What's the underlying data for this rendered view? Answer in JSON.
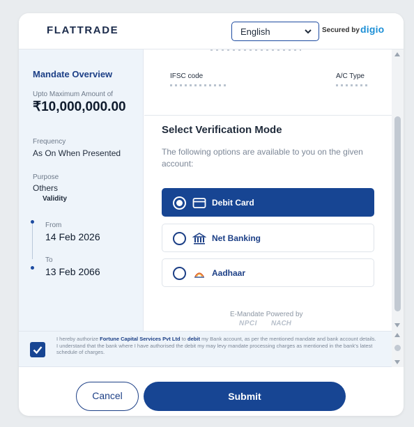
{
  "header": {
    "logo_text": "FLATTRADE",
    "language_selected": "English",
    "secured_by_label": "Secured by",
    "secured_by_brand": "digio"
  },
  "mandate": {
    "title": "Mandate Overview",
    "amount_label": "Upto Maximum Amount of",
    "amount_value": "₹10,000,000.00",
    "frequency_label": "Frequency",
    "frequency_value": "As On When Presented",
    "purpose_label": "Purpose",
    "purpose_value": "Others",
    "validity_label": "Validity",
    "from_label": "From",
    "from_value": "14 Feb 2026",
    "to_label": "To",
    "to_value": "13 Feb 2066"
  },
  "bank": {
    "ifsc_label": "IFSC code",
    "actype_label": "A/C Type"
  },
  "verification": {
    "title": "Select Verification Mode",
    "description": "The following options are available to you on the given account:",
    "options": [
      {
        "label": "Debit Card",
        "icon": "card-icon",
        "selected": true
      },
      {
        "label": "Net Banking",
        "icon": "bank-icon",
        "selected": false
      },
      {
        "label": "Aadhaar",
        "icon": "aadhaar-icon",
        "selected": false
      }
    ],
    "powered_by": "E-Mandate Powered by",
    "npci_logo": "NPCI",
    "nach_logo": "NACH"
  },
  "consent": {
    "checked": true,
    "line1_pre": "I hereby authorize",
    "company": "Fortune Capital Services Pvt Ltd",
    "line1_mid": "to",
    "debit_word": "debit",
    "line1_post": "my Bank account, as per the mentioned mandate and bank account details.",
    "line2": "I understand that the bank where I have authorised the debit my may levy mandate processing charges as mentioned in the bank's latest schedule of charges."
  },
  "actions": {
    "cancel_label": "Cancel",
    "submit_label": "Submit"
  },
  "colors": {
    "primary": "#174593",
    "panel_bg": "#eef4fa",
    "brand_digio": "#1c8fd6"
  }
}
